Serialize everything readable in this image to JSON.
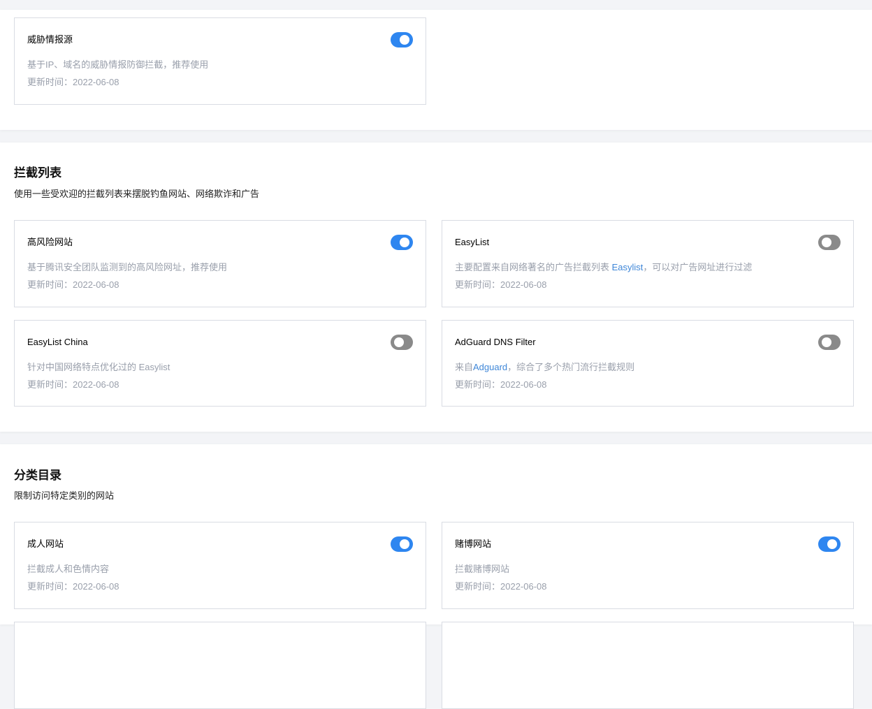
{
  "top_card": {
    "title": "威胁情报源",
    "desc": "基于IP、域名的威胁情报防御拦截，推荐使用",
    "time": "更新时间：2022-06-08",
    "enabled": true
  },
  "blocklist": {
    "title": "拦截列表",
    "subtitle": "使用一些受欢迎的拦截列表来摆脱钓鱼网站、网络欺诈和广告",
    "cards": [
      {
        "title": "高风险网站",
        "desc": "基于腾讯安全团队监测到的高风险网址，推荐使用",
        "time": "更新时间：2022-06-08",
        "enabled": true
      },
      {
        "title": "EasyList",
        "desc_before": "主要配置来自网络著名的广告拦截列表 ",
        "desc_link": "Easylist",
        "desc_after": "，可以对广告网址进行过滤",
        "time": "更新时间：2022-06-08",
        "enabled": false
      },
      {
        "title": "EasyList China",
        "desc": "针对中国网络特点优化过的 Easylist",
        "time": "更新时间：2022-06-08",
        "enabled": false
      },
      {
        "title": "AdGuard DNS Filter",
        "desc_before": "来自",
        "desc_link": "Adguard",
        "desc_after": "，综合了多个热门流行拦截规则",
        "time": "更新时间：2022-06-08",
        "enabled": false
      }
    ]
  },
  "category": {
    "title": "分类目录",
    "subtitle": "限制访问特定类别的网站",
    "cards": [
      {
        "title": "成人网站",
        "desc": "拦截成人和色情内容",
        "time": "更新时间：2022-06-08",
        "enabled": true
      },
      {
        "title": "赌博网站",
        "desc": "拦截赌博网站",
        "time": "更新时间：2022-06-08",
        "enabled": true
      }
    ]
  },
  "colors": {
    "toggle_on": "#2e86f0",
    "toggle_off": "#8a8a8a",
    "link": "#3f87d8",
    "muted_text": "#999fab"
  }
}
